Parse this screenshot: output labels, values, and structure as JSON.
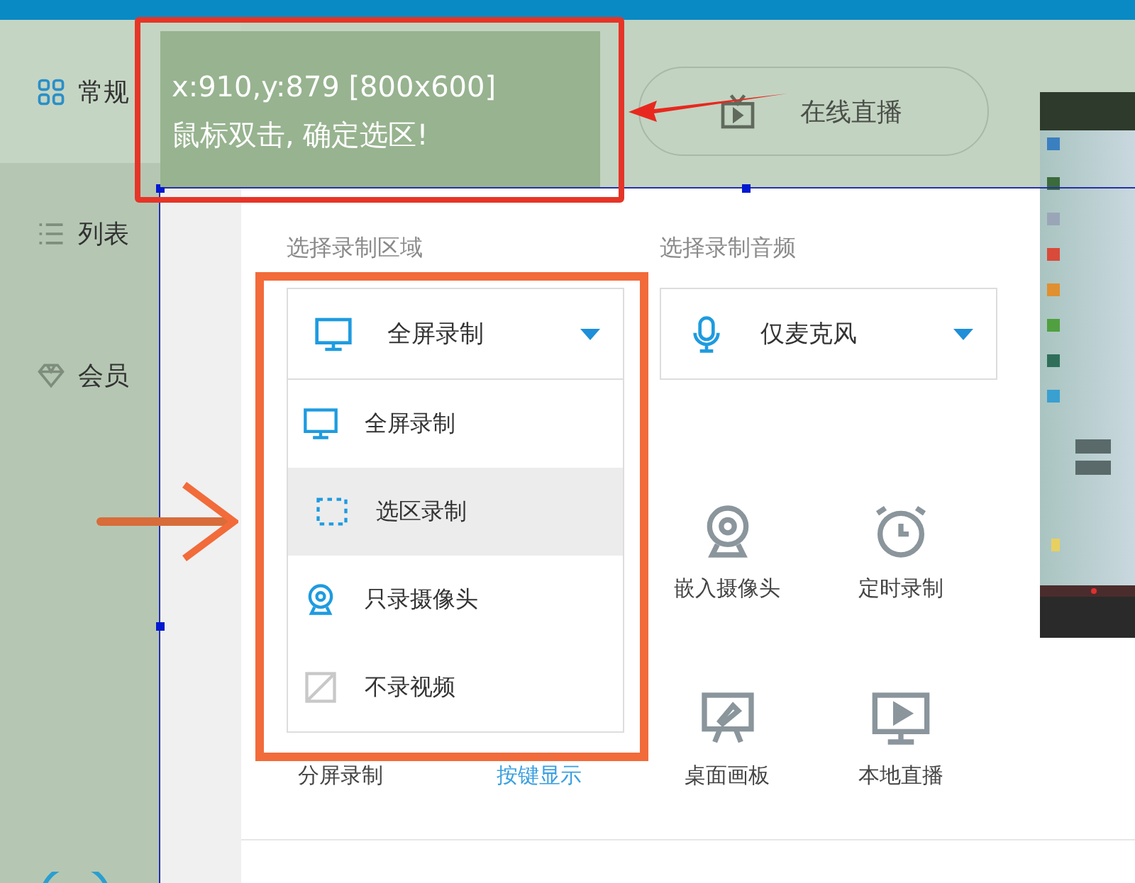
{
  "sidebar": {
    "items": [
      {
        "label": "常规",
        "selected": true
      },
      {
        "label": "列表",
        "selected": false
      },
      {
        "label": "会员",
        "selected": false
      }
    ]
  },
  "tabs": [
    {
      "label": "在线直播",
      "selected": false
    }
  ],
  "area": {
    "label": "选择录制区域",
    "value": "全屏录制",
    "expanded": true,
    "options": [
      {
        "label": "全屏录制",
        "highlighted": false
      },
      {
        "label": "选区录制",
        "highlighted": true
      },
      {
        "label": "只录摄像头",
        "highlighted": false
      },
      {
        "label": "不录视频",
        "highlighted": false
      }
    ]
  },
  "audio": {
    "label": "选择录制音频",
    "value": "仅麦克风"
  },
  "features": [
    {
      "items": [
        {
          "label": "嵌入摄像头",
          "kind": "feature"
        },
        {
          "label": "定时录制",
          "kind": "feature"
        }
      ]
    },
    {
      "items": [
        {
          "label": "分屏录制",
          "kind": "feature"
        },
        {
          "label": "按键显示",
          "kind": "link"
        },
        {
          "label": "桌面画板",
          "kind": "feature"
        },
        {
          "label": "本地直播",
          "kind": "feature"
        }
      ]
    }
  ],
  "tooltip": {
    "lines": [
      "x:910,y:879 [800x600]",
      "鼠标双击, 确定选区!"
    ]
  }
}
